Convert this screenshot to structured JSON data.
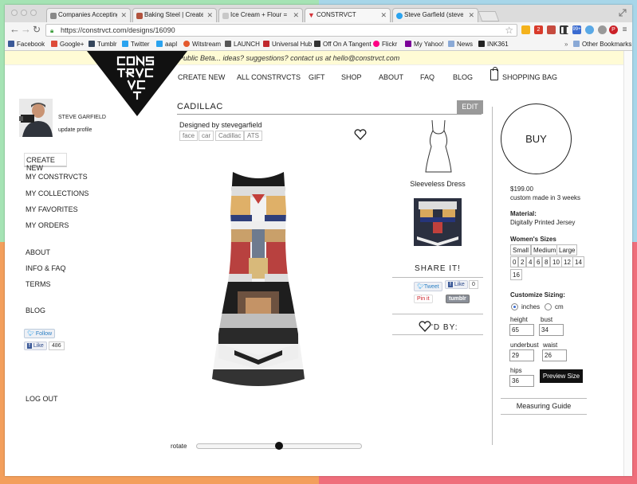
{
  "browser": {
    "tabs": [
      {
        "title": "Companies Accepting Onl",
        "color": "#888"
      },
      {
        "title": "Baking Steel | Create The",
        "color": "#b2533e"
      },
      {
        "title": "Ice Cream + Flour = Bread",
        "color": "#c8c8c8"
      },
      {
        "title": "CONSTRVCT",
        "color": "#d4343a"
      },
      {
        "title": "Steve Garfield (stevegarfi",
        "color": "#2aa3ef"
      }
    ],
    "url": "https://constrvct.com/designs/16090",
    "bookmarks": [
      {
        "label": "Facebook",
        "color": "#3b5998"
      },
      {
        "label": "Google+",
        "color": "#dd4b39"
      },
      {
        "label": "Tumblr",
        "color": "#35465c"
      },
      {
        "label": "Twitter",
        "color": "#2aa3ef"
      },
      {
        "label": "aapl",
        "color": "#2aa3ef"
      },
      {
        "label": "Witstream",
        "color": "#e45a2f"
      },
      {
        "label": "LAUNCH",
        "color": "#555"
      },
      {
        "label": "Universal Hub",
        "color": "#c0282d"
      },
      {
        "label": "Off On A Tangent",
        "color": "#333"
      },
      {
        "label": "Flickr",
        "color": "#ff0084"
      },
      {
        "label": "My Yahoo!",
        "color": "#7b0099"
      },
      {
        "label": "News",
        "color": "#8aa9d6"
      },
      {
        "label": "INK361",
        "color": "#222"
      }
    ],
    "overflow": "»",
    "other_bookmarks": "Other Bookmarks",
    "ext_badges": {
      "badge_red": "2",
      "badge_blue": "99+"
    }
  },
  "site": {
    "beta_text": "Public Beta... ideas? suggestions? contact us at hello@constrvct.com",
    "nav": [
      "CREATE NEW",
      "ALL CONSTRVCTS",
      "GIFT",
      "SHOP",
      "ABOUT",
      "FAQ",
      "BLOG",
      "SHOPPING BAG"
    ]
  },
  "user": {
    "name": "STEVE GARFIELD",
    "update": "update profile"
  },
  "sidebar": {
    "items": [
      "CREATE NEW",
      "MY CONSTRVCTS",
      "MY COLLECTIONS",
      "MY FAVORITES",
      "MY ORDERS",
      "ABOUT",
      "INFO & FAQ",
      "TERMS",
      "BLOG"
    ],
    "follow": "Follow",
    "like": "Like",
    "like_count": "486",
    "logout": "LOG OUT"
  },
  "design": {
    "title": "CADILLAC",
    "edit": "EDIT",
    "designed_by": "Designed by stevegarfield",
    "tags": [
      "face",
      "car",
      "Cadillac",
      "ATS"
    ],
    "rotate": "rotate",
    "rotate_value": 0.5
  },
  "product": {
    "type": "Sleeveless Dress",
    "share_title": "SHARE IT!",
    "tweet": "Tweet",
    "like": "Like",
    "like_count": "0",
    "pinit": "Pin it",
    "tumblr": "tumblr",
    "liked_by": "'D BY:"
  },
  "purchase": {
    "buy": "BUY",
    "price": "$199.00",
    "custom": "custom made in 3 weeks",
    "material_label": "Material:",
    "material": "Digitally Printed Jersey",
    "sizes_label": "Women's Sizes",
    "sizes_row1": [
      "Small",
      "Medium",
      "Large"
    ],
    "sizes_row2": [
      "0",
      "2",
      "4",
      "6",
      "8",
      "10",
      "12",
      "14"
    ],
    "sizes_row3": [
      "16"
    ],
    "customize_label": "Customize Sizing:",
    "unit_inches": "inches",
    "unit_cm": "cm",
    "height_label": "height",
    "height": "65",
    "bust_label": "bust",
    "bust": "34",
    "underbust_label": "underbust",
    "underbust": "29",
    "waist_label": "waist",
    "waist": "26",
    "hips_label": "hips",
    "hips": "36",
    "preview": "Preview Size",
    "measuring": "Measuring Guide"
  }
}
